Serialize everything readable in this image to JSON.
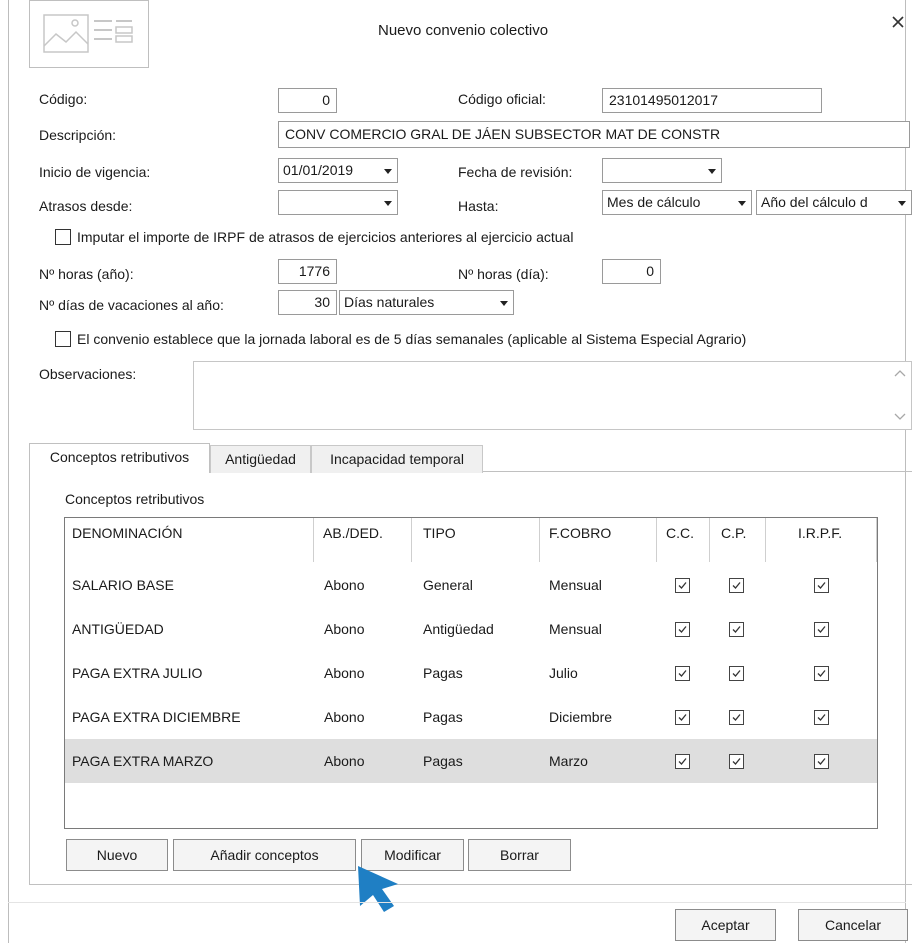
{
  "window": {
    "title": "Nuevo convenio colectivo"
  },
  "form": {
    "codigo_label": "Código:",
    "codigo_value": "0",
    "codigo_oficial_label": "Código oficial:",
    "codigo_oficial_value": "23101495012017",
    "descripcion_label": "Descripción:",
    "descripcion_value": "CONV COMERCIO GRAL DE JÁEN SUBSECTOR MAT DE CONSTR",
    "inicio_label": "Inicio de vigencia:",
    "inicio_value": "01/01/2019",
    "revision_label": "Fecha de revisión:",
    "revision_value": "",
    "atrasos_label": "Atrasos desde:",
    "atrasos_value": "",
    "hasta_label": "Hasta:",
    "hasta_mes_value": "Mes de cálculo",
    "hasta_anio_value": "Año del cálculo d",
    "imputar_label": "Imputar el importe de IRPF de atrasos de ejercicios anteriores al ejercicio actual",
    "imputar_checked": false,
    "horas_anio_label": "Nº horas (año):",
    "horas_anio_value": "1776",
    "horas_dia_label": "Nº horas (día):",
    "horas_dia_value": "0",
    "vacaciones_label": "Nº días de vacaciones al año:",
    "vacaciones_value": "30",
    "vacaciones_tipo": "Días naturales",
    "jornada_label": "El convenio establece que la jornada laboral es de 5 días semanales (aplicable al Sistema Especial Agrario)",
    "jornada_checked": false,
    "observaciones_label": "Observaciones:",
    "observaciones_value": ""
  },
  "tabs": [
    {
      "label": "Conceptos retributivos",
      "active": true
    },
    {
      "label": "Antigüedad",
      "active": false
    },
    {
      "label": "Incapacidad temporal",
      "active": false
    }
  ],
  "conceptos": {
    "section_title": "Conceptos retributivos",
    "headers": [
      "DENOMINACIÓN",
      "AB./DED.",
      "TIPO",
      "F.COBRO",
      "C.C.",
      "C.P.",
      "I.R.P.F."
    ],
    "rows": [
      {
        "denominacion": "SALARIO BASE",
        "abded": "Abono",
        "tipo": "General",
        "fcobro": "Mensual",
        "cc": true,
        "cp": true,
        "irpf": true
      },
      {
        "denominacion": "ANTIGÜEDAD",
        "abded": "Abono",
        "tipo": "Antigüedad",
        "fcobro": "Mensual",
        "cc": true,
        "cp": true,
        "irpf": true
      },
      {
        "denominacion": "PAGA EXTRA JULIO",
        "abded": "Abono",
        "tipo": "Pagas",
        "fcobro": "Julio",
        "cc": true,
        "cp": true,
        "irpf": true
      },
      {
        "denominacion": "PAGA EXTRA DICIEMBRE",
        "abded": "Abono",
        "tipo": "Pagas",
        "fcobro": "Diciembre",
        "cc": true,
        "cp": true,
        "irpf": true
      },
      {
        "denominacion": "PAGA EXTRA MARZO",
        "abded": "Abono",
        "tipo": "Pagas",
        "fcobro": "Marzo",
        "cc": true,
        "cp": true,
        "irpf": true
      }
    ],
    "selected_row": 4
  },
  "buttons": {
    "nuevo": "Nuevo",
    "anadir": "Añadir conceptos",
    "modificar": "Modificar",
    "borrar": "Borrar",
    "aceptar": "Aceptar",
    "cancelar": "Cancelar"
  },
  "colors": {
    "cursor": "#1f7fc4",
    "selected_row": "#dedede"
  }
}
